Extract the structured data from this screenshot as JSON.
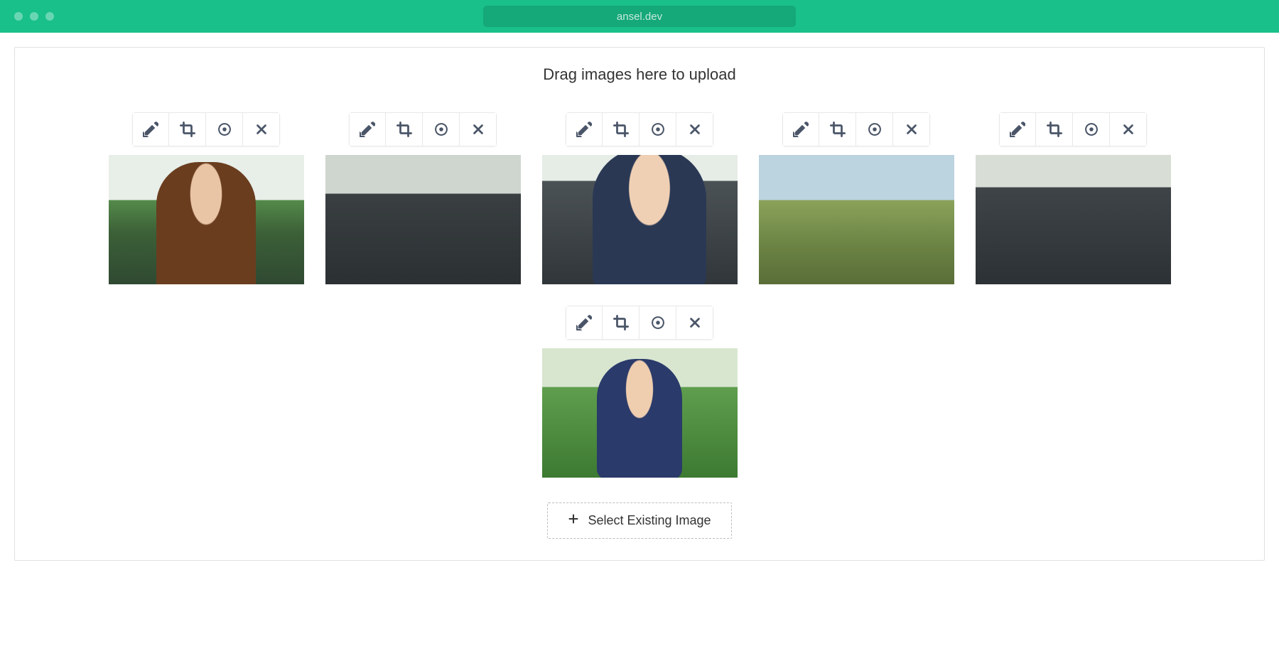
{
  "browser": {
    "url": "ansel.dev"
  },
  "upload": {
    "dropzone_label": "Drag images here to upload",
    "select_existing_label": "Select Existing Image"
  },
  "toolbar": {
    "edit": "Edit",
    "crop": "Crop",
    "focal": "Set Focal Point",
    "delete": "Delete"
  },
  "thumbnails": [
    {
      "class": "ph1"
    },
    {
      "class": "ph2"
    },
    {
      "class": "ph3"
    },
    {
      "class": "ph4"
    },
    {
      "class": "ph5"
    },
    {
      "class": "ph6"
    }
  ]
}
